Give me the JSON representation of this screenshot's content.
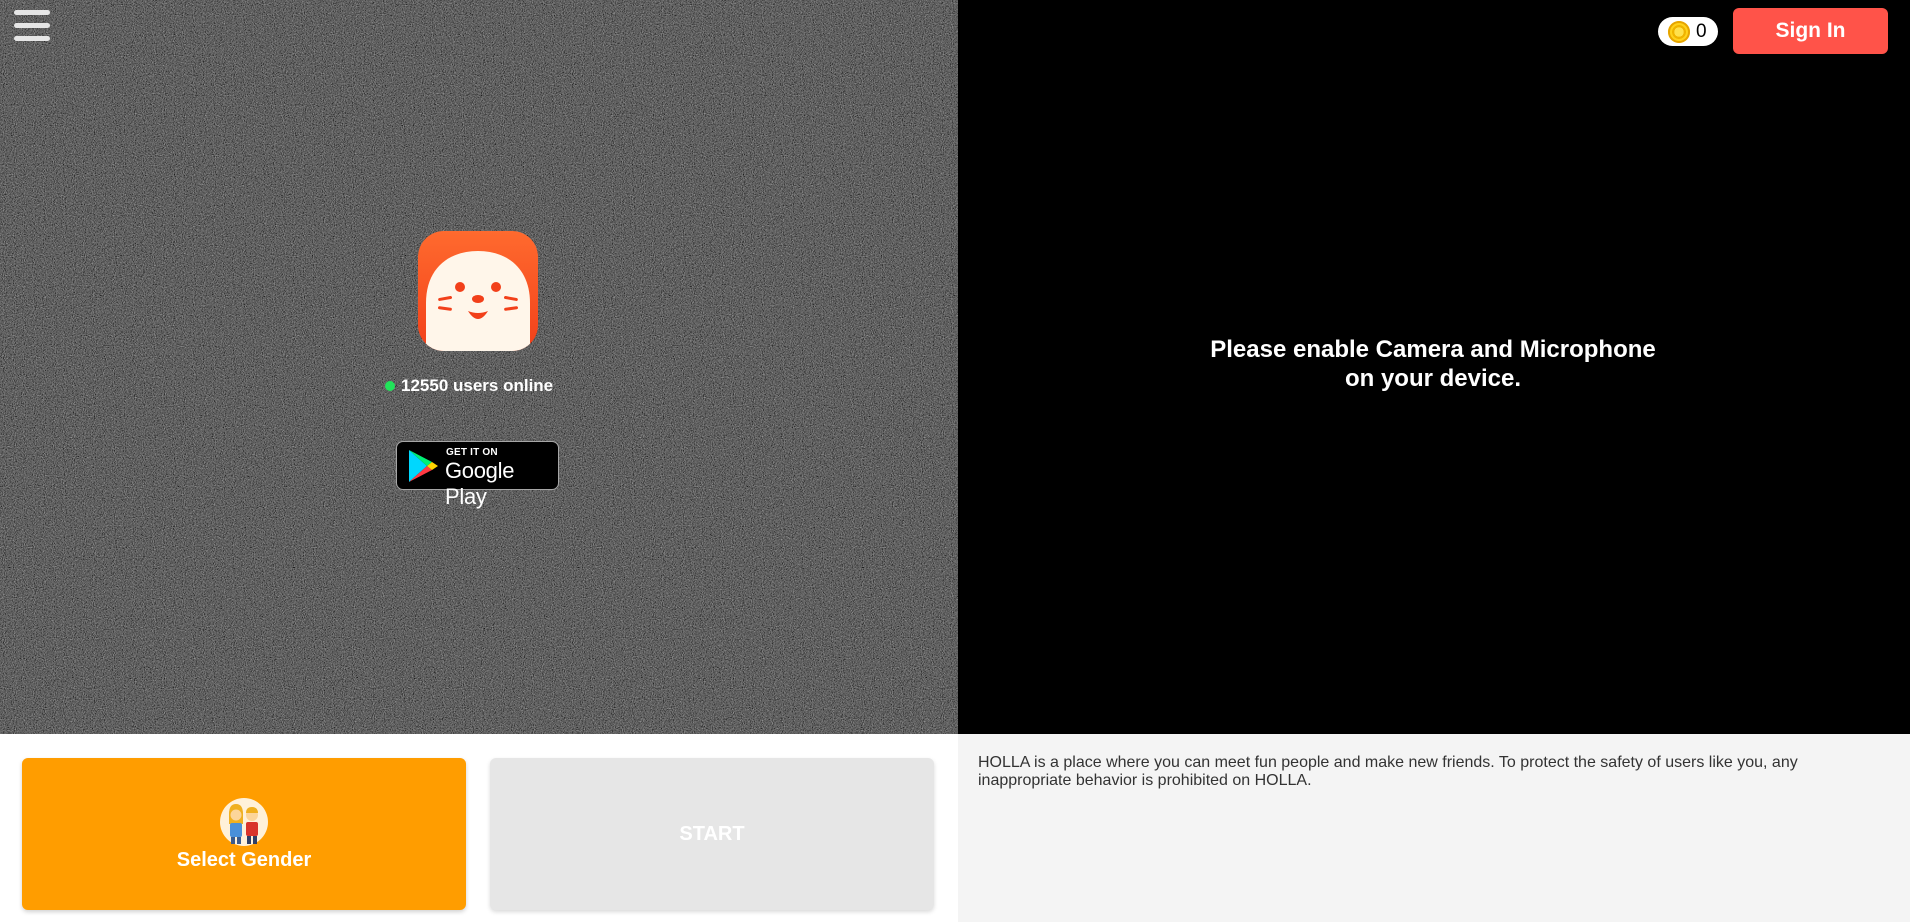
{
  "header": {
    "menu_icon": "hamburger-icon",
    "coins": {
      "icon": "coin-icon",
      "count": "0"
    },
    "signin_label": "Sign In"
  },
  "hero": {
    "logo_icon": "seal-app-logo",
    "online_text": "12550 users online",
    "google_play": {
      "small_text": "GET IT ON",
      "big_text": "Google Play"
    }
  },
  "camera_panel": {
    "line1": "Please enable Camera and Microphone",
    "line2": "on your device."
  },
  "controls": {
    "gender_label": "Select Gender",
    "gender_icon": "couple-icon",
    "start_label": "START"
  },
  "notice": {
    "text": "HOLLA is a place where you can meet fun people and make new friends. To protect the safety of users like you, any inappropriate behavior is prohibited on HOLLA."
  },
  "colors": {
    "signin": "#ff5349",
    "gender_button": "#ff9d00",
    "start_button": "#e6e6e6",
    "online_dot": "#21e35a"
  }
}
